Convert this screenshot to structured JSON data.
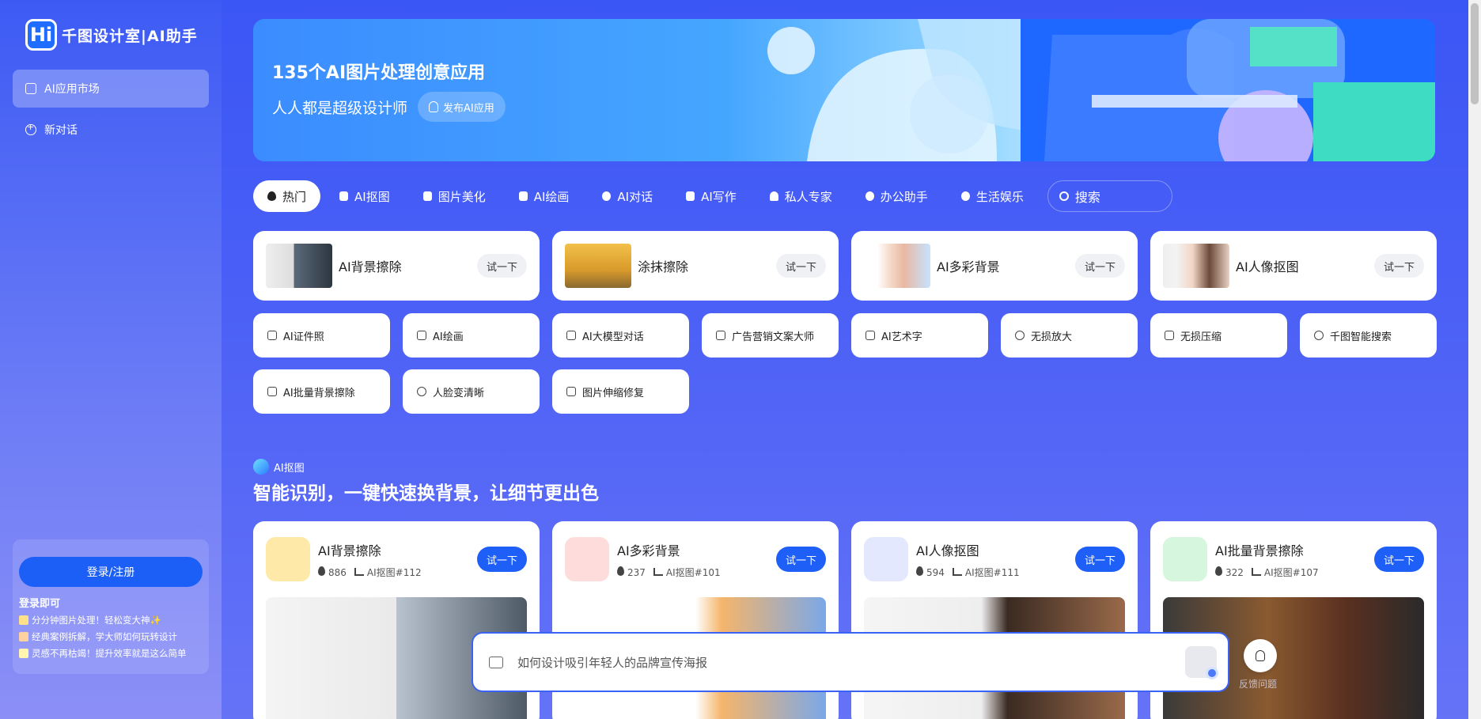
{
  "sidebar": {
    "logo_mark": "Hi",
    "logo_text": "千图设计室|AI助手",
    "items": [
      {
        "label": "AI应用市场",
        "icon": "store-icon"
      },
      {
        "label": "新对话",
        "icon": "plus-circle-icon"
      }
    ],
    "login_label": "登录/注册",
    "promo_title": "登录即可",
    "promo_lines": [
      "分分钟图片处理！轻松变大神✨",
      "经典案例拆解，学大师如何玩转设计",
      "灵感不再枯竭！提升效率就是这么简单"
    ]
  },
  "banner": {
    "title": "135个AI图片处理创意应用",
    "subtitle": "人人都是超级设计师",
    "publish_label": "发布AI应用"
  },
  "tabs": [
    {
      "label": "热门",
      "icon": "fire-icon",
      "active": true
    },
    {
      "label": "AI抠图",
      "icon": "cutout-icon"
    },
    {
      "label": "图片美化",
      "icon": "beautify-icon"
    },
    {
      "label": "AI绘画",
      "icon": "image-icon"
    },
    {
      "label": "AI对话",
      "icon": "chat-icon"
    },
    {
      "label": "AI写作",
      "icon": "book-icon"
    },
    {
      "label": "私人专家",
      "icon": "user-icon"
    },
    {
      "label": "办公助手",
      "icon": "office-icon"
    },
    {
      "label": "生活娱乐",
      "icon": "smile-icon"
    }
  ],
  "search": {
    "placeholder": "搜索"
  },
  "featured_apps": [
    {
      "name": "AI背景擦除",
      "try_label": "试一下"
    },
    {
      "name": "涂抹擦除",
      "try_label": "试一下"
    },
    {
      "name": "AI多彩背景",
      "try_label": "试一下"
    },
    {
      "name": "AI人像抠图",
      "try_label": "试一下"
    }
  ],
  "tools": [
    {
      "label": "AI证件照",
      "icon": "id-card-icon"
    },
    {
      "label": "AI绘画",
      "icon": "paint-icon"
    },
    {
      "label": "AI大模型对话",
      "icon": "model-icon"
    },
    {
      "label": "广告营销文案大师",
      "icon": "marketing-icon"
    },
    {
      "label": "AI艺术字",
      "icon": "art-text-icon"
    },
    {
      "label": "无损放大",
      "icon": "zoom-in-icon"
    },
    {
      "label": "无损压缩",
      "icon": "compress-icon"
    },
    {
      "label": "千图智能搜索",
      "icon": "search-icon"
    },
    {
      "label": "AI批量背景擦除",
      "icon": "batch-icon"
    },
    {
      "label": "人脸变清晰",
      "icon": "face-icon"
    },
    {
      "label": "图片伸缩修复",
      "icon": "resize-icon"
    }
  ],
  "section": {
    "tag": "AI抠图",
    "title": "智能识别，一键快速换背景，让细节更出色"
  },
  "section_cards": [
    {
      "name": "AI背景擦除",
      "count": "886",
      "ref": "AI抠图#112",
      "try_label": "试一下"
    },
    {
      "name": "AI多彩背景",
      "count": "237",
      "ref": "AI抠图#101",
      "try_label": "试一下"
    },
    {
      "name": "AI人像抠图",
      "count": "594",
      "ref": "AI抠图#111",
      "try_label": "试一下"
    },
    {
      "name": "AI批量背景擦除",
      "count": "322",
      "ref": "AI抠图#107",
      "try_label": "试一下"
    }
  ],
  "prompt": {
    "placeholder": "如何设计吸引年轻人的品牌宣传海报"
  },
  "feedback_label": "反馈问题"
}
